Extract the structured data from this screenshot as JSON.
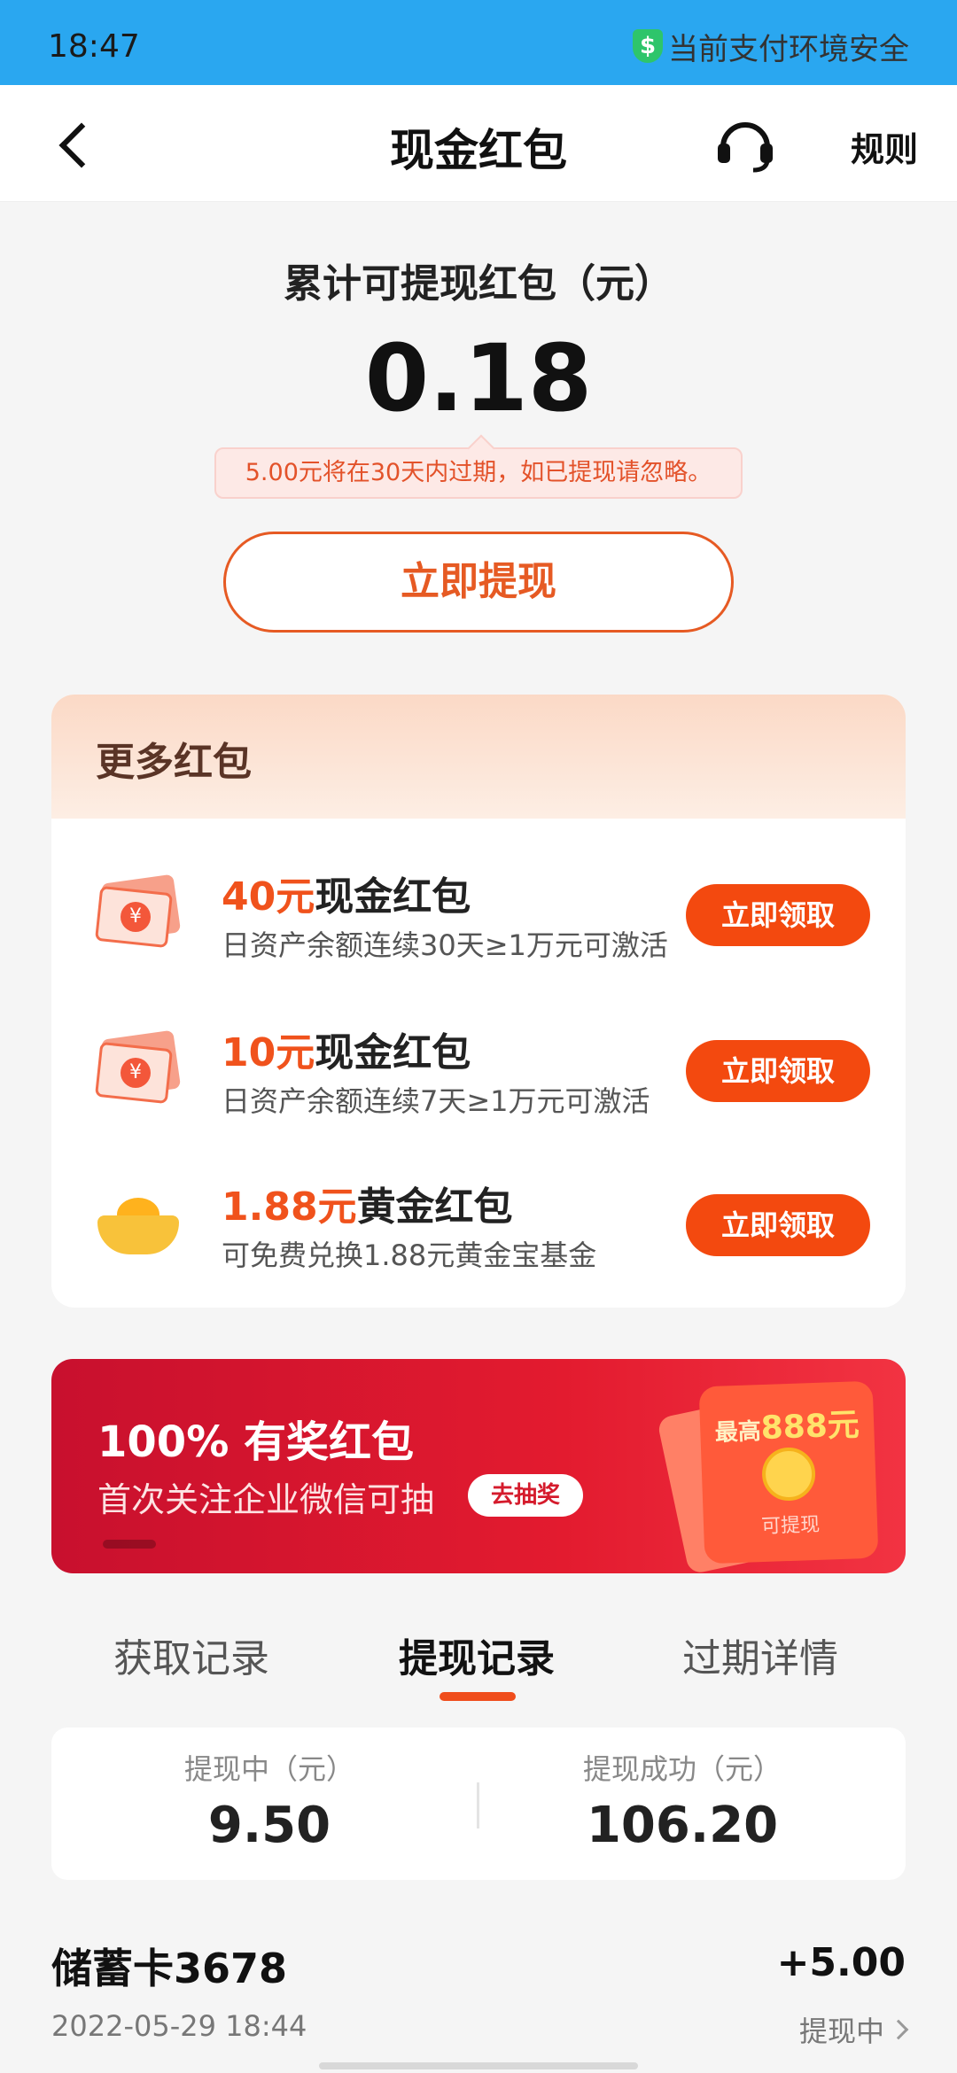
{
  "status_bar": {
    "time": "18:47",
    "secure_text": "当前支付环境安全",
    "shield_glyph": "$"
  },
  "nav": {
    "title": "现金红包",
    "rules": "规则",
    "service_icon": "headset-icon"
  },
  "balance": {
    "label": "累计可提现红包（元）",
    "amount": "0.18",
    "expire_tip": "5.00元将在30天内过期，如已提现请忽略。",
    "withdraw_button": "立即提现"
  },
  "more": {
    "title": "更多红包",
    "items": [
      {
        "amount": "40元",
        "name": "现金红包",
        "desc": "日资产余额连续30天≥1万元可激活",
        "button": "立即领取",
        "icon": "cash-red-packet-icon"
      },
      {
        "amount": "10元",
        "name": "现金红包",
        "desc": "日资产余额连续7天≥1万元可激活",
        "button": "立即领取",
        "icon": "cash-red-packet-icon"
      },
      {
        "amount": "1.88元",
        "name": "黄金红包",
        "desc": "可免费兑换1.88元黄金宝基金",
        "button": "立即领取",
        "icon": "gold-ingot-icon"
      }
    ]
  },
  "banner": {
    "title": "100% 有奖红包",
    "subtitle": "首次关注企业微信可抽",
    "cta": "去抽奖",
    "max_prefix": "最高",
    "max_value": "888元",
    "withdrawable": "可提现"
  },
  "tabs": [
    {
      "label": "获取记录",
      "active": false
    },
    {
      "label": "提现记录",
      "active": true
    },
    {
      "label": "过期详情",
      "active": false
    }
  ],
  "summary": {
    "pending_label": "提现中（元）",
    "pending_value": "9.50",
    "success_label": "提现成功（元）",
    "success_value": "106.20"
  },
  "records": [
    {
      "title": "储蓄卡3678",
      "date": "2022-05-29 18:44",
      "amount": "+5.00",
      "status": "提现中"
    }
  ],
  "colors": {
    "accent": "#f3490f",
    "status_bar": "#2aa7f0",
    "banner_red": "#e31b2f"
  }
}
